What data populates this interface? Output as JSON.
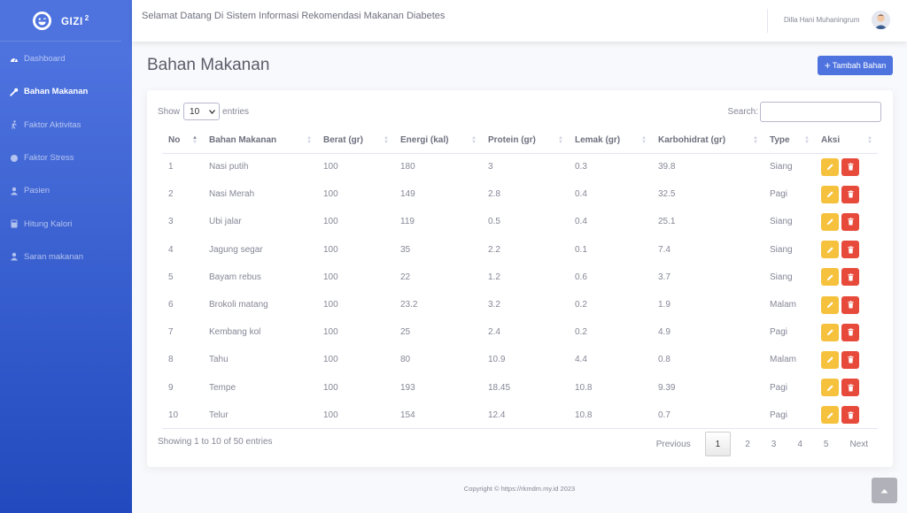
{
  "brand": {
    "name": "GIZI",
    "sup": "2"
  },
  "sidebar": {
    "items": [
      {
        "label": "Dashboard",
        "icon": "gauge-icon"
      },
      {
        "label": "Bahan Makanan",
        "icon": "wrench-icon",
        "active": true
      },
      {
        "label": "Faktor Aktivitas",
        "icon": "walking-icon"
      },
      {
        "label": "Faktor Stress",
        "icon": "circle-icon"
      },
      {
        "label": "Pasien",
        "icon": "user-icon"
      },
      {
        "label": "Hitung Kalori",
        "icon": "calculator-icon"
      },
      {
        "label": "Saran makanan",
        "icon": "user-icon"
      }
    ]
  },
  "topbar": {
    "welcome": "Selamat Datang Di Sistem Informasi Rekomendasi Makanan Diabetes",
    "user_name": "Dilla Hani Muhaningrum"
  },
  "page": {
    "title": "Bahan Makanan",
    "add_button": "Tambah Bahan"
  },
  "table_controls": {
    "show_label": "Show",
    "page_size": "10",
    "entries_label": "entries",
    "search_label": "Search:"
  },
  "table": {
    "columns": [
      "No",
      "Bahan Makanan",
      "Berat (gr)",
      "Energi (kal)",
      "Protein (gr)",
      "Lemak (gr)",
      "Karbohidrat (gr)",
      "Type",
      "Aksi"
    ],
    "rows": [
      [
        "1",
        "Nasi putih",
        "100",
        "180",
        "3",
        "0.3",
        "39.8",
        "Siang"
      ],
      [
        "2",
        "Nasi Merah",
        "100",
        "149",
        "2.8",
        "0.4",
        "32.5",
        "Pagi"
      ],
      [
        "3",
        "Ubi jalar",
        "100",
        "119",
        "0.5",
        "0.4",
        "25.1",
        "Siang"
      ],
      [
        "4",
        "Jagung segar",
        "100",
        "35",
        "2.2",
        "0.1",
        "7.4",
        "Siang"
      ],
      [
        "5",
        "Bayam rebus",
        "100",
        "22",
        "1.2",
        "0.6",
        "3.7",
        "Siang"
      ],
      [
        "6",
        "Brokoli matang",
        "100",
        "23.2",
        "3.2",
        "0.2",
        "1.9",
        "Malam"
      ],
      [
        "7",
        "Kembang kol",
        "100",
        "25",
        "2.4",
        "0.2",
        "4.9",
        "Pagi"
      ],
      [
        "8",
        "Tahu",
        "100",
        "80",
        "10.9",
        "4.4",
        "0.8",
        "Malam"
      ],
      [
        "9",
        "Tempe",
        "100",
        "193",
        "18.45",
        "10.8",
        "9.39",
        "Pagi"
      ],
      [
        "10",
        "Telur",
        "100",
        "154",
        "12.4",
        "10.8",
        "0.7",
        "Pagi"
      ]
    ]
  },
  "pagination": {
    "info": "Showing 1 to 10 of 50 entries",
    "previous": "Previous",
    "pages": [
      "1",
      "2",
      "3",
      "4",
      "5"
    ],
    "current": "1",
    "next": "Next"
  },
  "footer": {
    "text": "Copyright © https://rkmdm.my.id 2023"
  },
  "colors": {
    "primary": "#4e73df",
    "warning": "#f6c23e",
    "danger": "#e74a3b"
  }
}
